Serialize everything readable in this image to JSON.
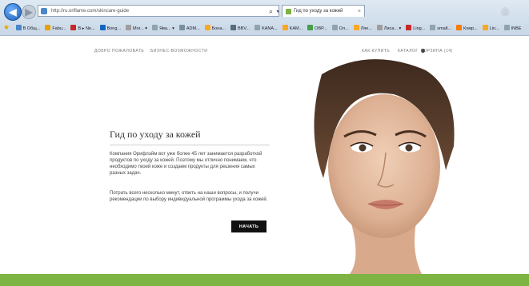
{
  "browser": {
    "address": "http://ru.oriflame.com/skincare-guide",
    "tools": "⌕ ▾ ☰ ↻ ✖",
    "tab_title": "Гид по уходу за кожей",
    "tab_close": "×",
    "home_glyph": "⌂",
    "favorites": [
      {
        "label": "В Общ...",
        "color": "#4a86c8"
      },
      {
        "label": "Fabu...",
        "color": "#e8a000"
      },
      {
        "label": "В ▸ Ne...",
        "color": "#c62828"
      },
      {
        "label": "Bong...",
        "color": "#1565c0"
      },
      {
        "label": "Mor... ▾",
        "color": "#9e9e9e"
      },
      {
        "label": "Ява... ▾",
        "color": "#90a4ae"
      },
      {
        "label": "ADM...",
        "color": "#78909c"
      },
      {
        "label": "Бона...",
        "color": "#f9a825"
      },
      {
        "label": "BBV...",
        "color": "#546e7a"
      },
      {
        "label": "KANA...",
        "color": "#90a4ae"
      },
      {
        "label": "KAM...",
        "color": "#f9a825"
      },
      {
        "label": "OBP...",
        "color": "#43a047"
      },
      {
        "label": "Ол...",
        "color": "#90a4ae"
      },
      {
        "label": "Ляе...",
        "color": "#f9a825"
      },
      {
        "label": "Лиса... ▾",
        "color": "#9e9e9e"
      },
      {
        "label": "Ling...",
        "color": "#c62828"
      },
      {
        "label": "smalt...",
        "color": "#90a4ae"
      },
      {
        "label": "Комр...",
        "color": "#f57c00"
      },
      {
        "label": "Lin...",
        "color": "#f9a825"
      },
      {
        "label": "INBE",
        "color": "#90a4ae"
      }
    ]
  },
  "site_nav": {
    "left": [
      "ДОБРО ПОЖАЛОВАТЬ",
      "БИЗНЕС-ВОЗМОЖНОСТИ"
    ],
    "right": [
      "КАК КУПИТЬ",
      "КАТАЛОГ",
      "КОРЗИНА (14)"
    ]
  },
  "hero": {
    "title": "Гид по уходу за кожей",
    "paragraph1": "Компания Орифлэйм вот уже более 45 лет занимается разработкой продуктов по уходу за кожей. Поэтому мы отлично понимаем, что необходимо твоей коже и создаем продукты для решения самых разных задач.",
    "paragraph2": "Потрать всего несколько минут, ответь на наши вопросы, и получи рекомендации по выбору индивидуальной программы ухода за кожей.",
    "start_label": "НАЧАТЬ"
  },
  "colors": {
    "accent_green": "#7db443",
    "button_black": "#111111"
  }
}
